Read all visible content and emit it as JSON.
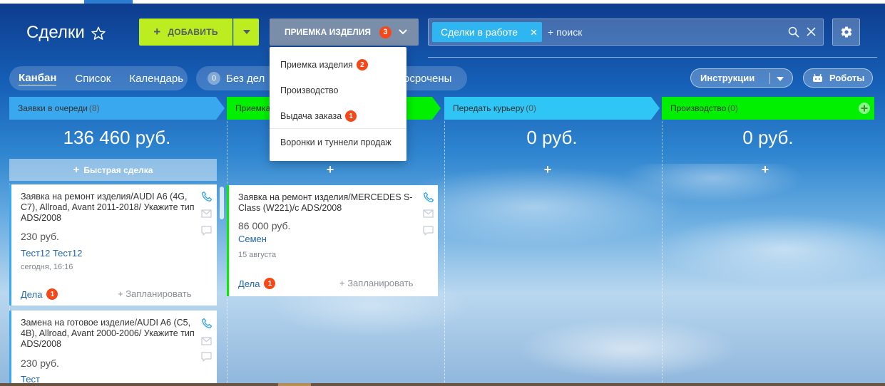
{
  "header": {
    "title": "Сделки",
    "add_label": "ДОБАВИТЬ",
    "pipeline_label": "ПРИЕМКА ИЗДЕЛИЯ",
    "pipeline_badge": "3",
    "filter_chip": "Сделки в работе",
    "search_placeholder": "+ поиск"
  },
  "views": {
    "tabs": [
      {
        "label": "Канбан",
        "active": true
      },
      {
        "label": "Список",
        "active": false
      },
      {
        "label": "Календарь",
        "active": false
      }
    ]
  },
  "counters": {
    "no_tasks_count": "0",
    "no_tasks_label": "Без дел",
    "overdue_label": "Просрочены",
    "overdue_visible_label": "осрочены"
  },
  "toolbar": {
    "instructions_label": "Инструкции",
    "robots_label": "Роботы"
  },
  "dropdown": {
    "items": [
      {
        "label": "Приемка изделия",
        "badge": "2"
      },
      {
        "label": "Производство",
        "badge": ""
      },
      {
        "label": "Выдача заказа",
        "badge": "1"
      },
      {
        "label": "Воронки и туннели продаж",
        "badge": ""
      }
    ]
  },
  "columns": [
    {
      "title": "Заявки в очереди",
      "count": "(8)",
      "sum": "136 460 руб.",
      "color": "#39a8ef"
    },
    {
      "title": "Приемка",
      "count": "",
      "sum": "",
      "color": "#00f000"
    },
    {
      "title": "Передать курьеру",
      "count": "(0)",
      "sum": "0 руб.",
      "color": "#2fc6f6"
    },
    {
      "title": "Производство",
      "count": "(0)",
      "sum": "0 руб.",
      "color": "#00f000"
    }
  ],
  "quick_deal_label": "Быстрая сделка",
  "cards": [
    {
      "title": "Заявка на ремонт изделия/AUDI A6 (4G, C7), Allroad, Avant 2011-2018/ Укажите тип ADS/2008",
      "price": "230 руб.",
      "client": "Тест12 Тест12",
      "date": "сегодня, 16:16",
      "tasks_label": "Дела",
      "tasks_badge": "1",
      "plan_label": "+ Запланировать"
    },
    {
      "title": "Замена на готовое изделие/AUDI A6 (C5, 4B), Allroad, Avant 2000-2006/ Укажите тип ADS/2008",
      "price": "230 руб.",
      "client": "Тест"
    },
    {
      "title": "Заявка на ремонт изделия/MERCEDES S-Class (W221)/c ADS/2008",
      "price": "86 000 руб.",
      "client": "Семен",
      "date": "15 августа",
      "tasks_label": "Дела",
      "tasks_badge": "1",
      "plan_label": "+ Запланировать"
    }
  ],
  "colors": {
    "add_button": "#bbed21",
    "pipeline_button": "#7b8ea9",
    "badge": "#f54819",
    "link": "#2067b0",
    "chip": "#2fb5ef"
  }
}
